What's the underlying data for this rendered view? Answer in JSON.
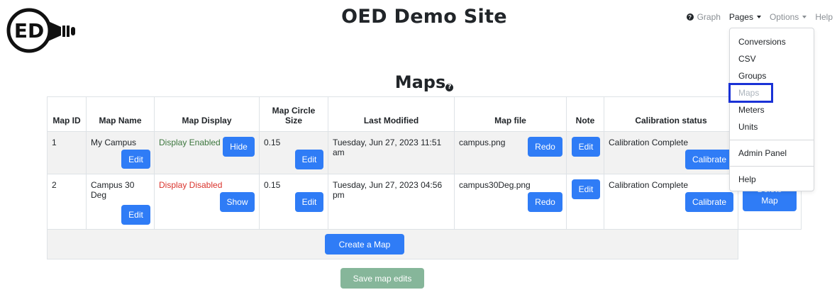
{
  "site": {
    "title": "OED Demo Site",
    "logo_text": "ED"
  },
  "nav": {
    "graph": "Graph",
    "pages": "Pages",
    "options": "Options",
    "help": "Help"
  },
  "dropdown": {
    "items": [
      "Conversions",
      "CSV",
      "Groups",
      "Maps",
      "Meters",
      "Units"
    ],
    "admin": "Admin Panel",
    "help": "Help"
  },
  "page": {
    "heading": "Maps",
    "help_icon": "?"
  },
  "table": {
    "headers": [
      "Map ID",
      "Map Name",
      "Map Display",
      "Map Circle Size",
      "Last Modified",
      "Map file",
      "Note",
      "Calibration status"
    ],
    "rows": [
      {
        "id": "1",
        "name": "My Campus",
        "display": "Display Enabled",
        "display_button": "Hide",
        "circle_size": "0.15",
        "modified": "Tuesday, Jun 27, 2023 11:51 am",
        "file": "campus.png",
        "calibration": "Calibration Complete"
      },
      {
        "id": "2",
        "name": "Campus 30 Deg",
        "display": "Display Disabled",
        "display_button": "Show",
        "circle_size": "0.15",
        "modified": "Tuesday, Jun 27, 2023 04:56 pm",
        "file": "campus30Deg.png",
        "calibration": "Calibration Complete"
      }
    ],
    "edit_label": "Edit",
    "redo_label": "Redo",
    "calibrate_label": "Calibrate",
    "delete_map_label": "Map",
    "delete_map_partial": "Delete"
  },
  "actions": {
    "create": "Create a Map",
    "save": "Save map edits"
  },
  "colors": {
    "primary": "#2f7cf6",
    "enabled": "#3c763d",
    "disabled": "#d9322b",
    "save_disabled": "#86b69a",
    "focus": "#1a32d6"
  }
}
